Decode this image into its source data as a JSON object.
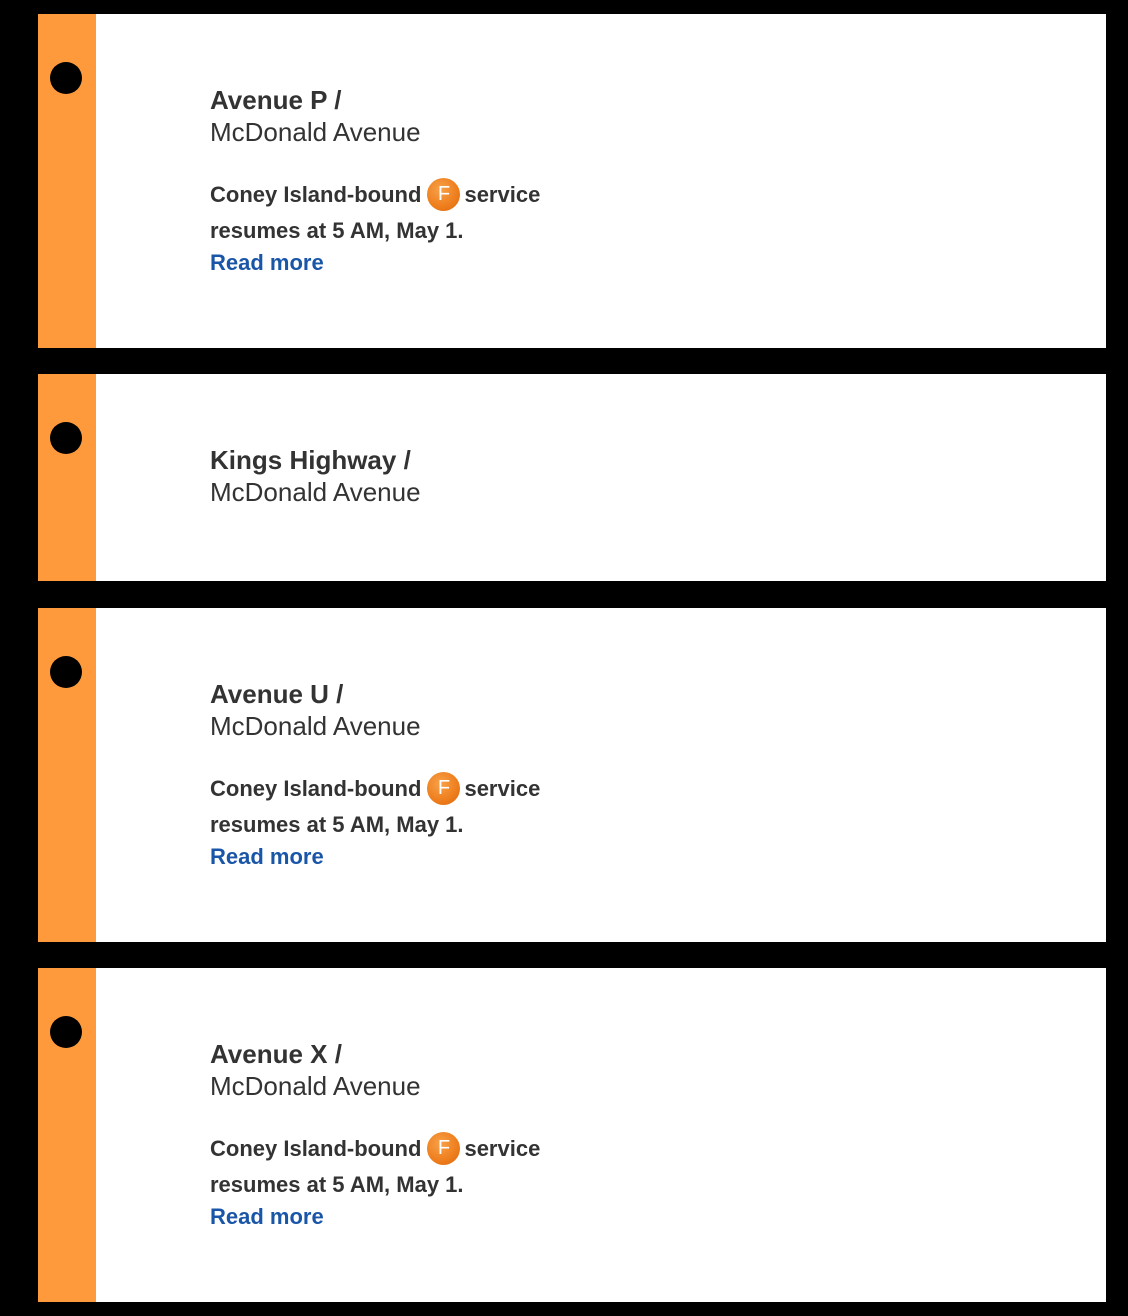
{
  "theme": {
    "line_color": "#ff9a3c",
    "bullet_color": "#ee7d1c",
    "link_color": "#1a56a8",
    "text_color": "#333333"
  },
  "stations": [
    {
      "name": "Avenue P /",
      "cross_street": "McDonald Avenue",
      "alert": {
        "before_bullet": "Coney Island-bound",
        "route": "F",
        "after_bullet": "service",
        "line2": "resumes at 5 AM, May 1."
      },
      "read_more": "Read more"
    },
    {
      "name": "Kings Highway /",
      "cross_street": "McDonald Avenue"
    },
    {
      "name": "Avenue U /",
      "cross_street": "McDonald Avenue",
      "alert": {
        "before_bullet": "Coney Island-bound",
        "route": "F",
        "after_bullet": "service",
        "line2": "resumes at 5 AM, May 1."
      },
      "read_more": "Read more"
    },
    {
      "name": "Avenue X /",
      "cross_street": "McDonald Avenue",
      "alert": {
        "before_bullet": "Coney Island-bound",
        "route": "F",
        "after_bullet": "service",
        "line2": "resumes at 5 AM, May 1."
      },
      "read_more": "Read more"
    }
  ]
}
